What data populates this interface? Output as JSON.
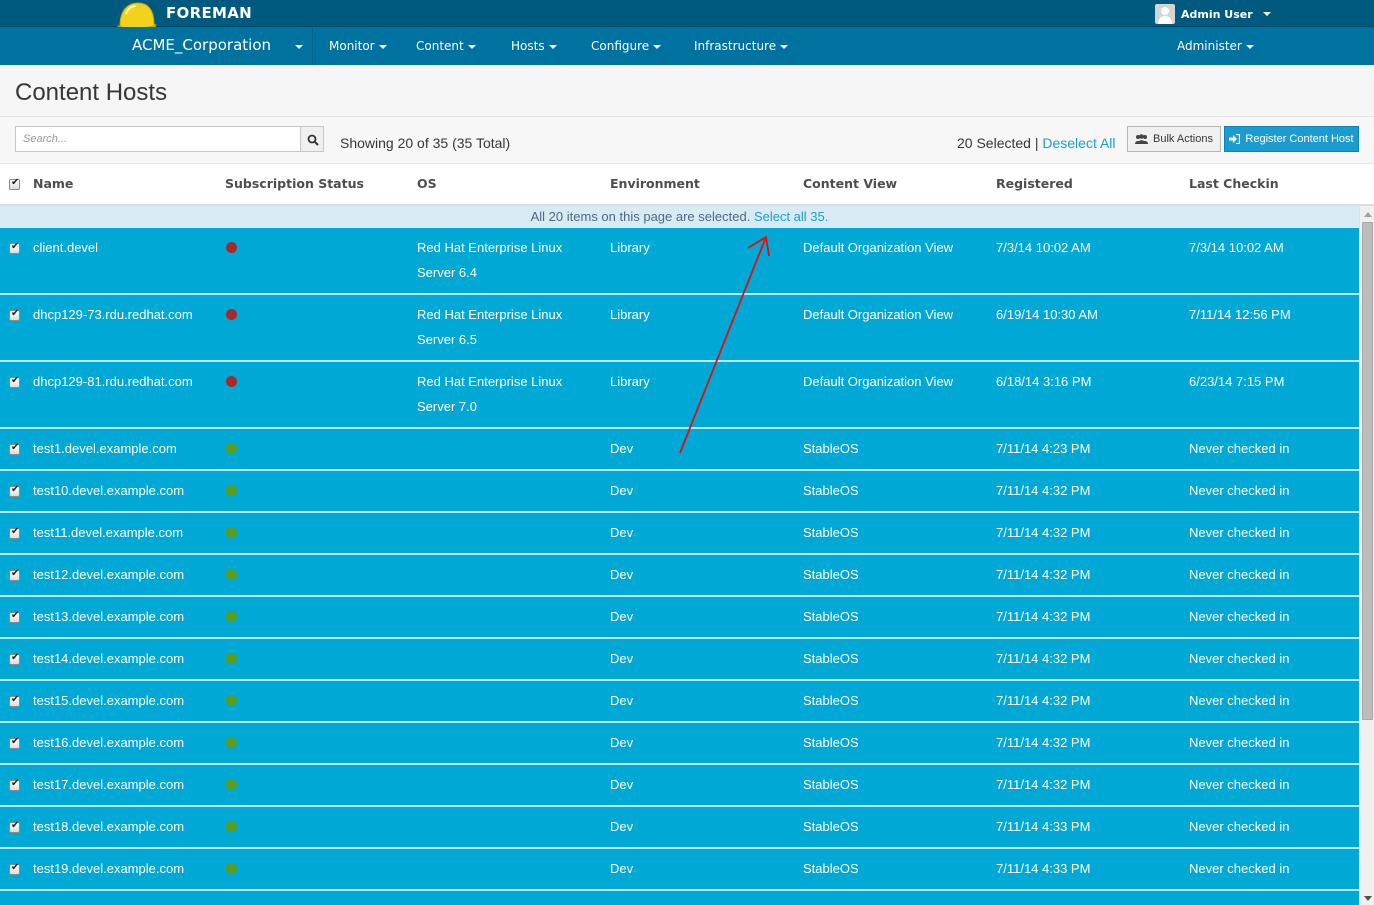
{
  "header": {
    "brand": "FOREMAN",
    "user": "Admin User",
    "organization": "ACME_Corporation",
    "menu": [
      {
        "label": "Monitor"
      },
      {
        "label": "Content"
      },
      {
        "label": "Hosts"
      },
      {
        "label": "Configure"
      },
      {
        "label": "Infrastructure"
      }
    ],
    "admin_menu": "Administer"
  },
  "page": {
    "title": "Content Hosts"
  },
  "toolbar": {
    "search_placeholder": "Search...",
    "showing": "Showing 20 of 35 (35 Total)",
    "selected_count": "20 Selected",
    "separator": "|",
    "deselect_all": "Deselect All",
    "bulk_actions": "Bulk Actions",
    "register": "Register Content Host"
  },
  "table": {
    "columns": [
      "Name",
      "Subscription Status",
      "OS",
      "Environment",
      "Content View",
      "Registered",
      "Last Checkin"
    ],
    "selection_banner": {
      "text": "All 20 items on this page are selected.",
      "link": "Select all 35."
    },
    "status_colors": {
      "red": "#a92828",
      "green": "#5a9e20"
    },
    "rows": [
      {
        "name": "client.devel",
        "status": "red",
        "os": [
          "Red Hat Enterprise Linux",
          "Server 6.4"
        ],
        "environment": "Library",
        "content_view": "Default Organization View",
        "registered": "7/3/14 10:02 AM",
        "last_checkin": "7/3/14 10:02 AM",
        "checked": true
      },
      {
        "name": "dhcp129-73.rdu.redhat.com",
        "status": "red",
        "os": [
          "Red Hat Enterprise Linux",
          "Server 6.5"
        ],
        "environment": "Library",
        "content_view": "Default Organization View",
        "registered": "6/19/14 10:30 AM",
        "last_checkin": "7/11/14 12:56 PM",
        "checked": true
      },
      {
        "name": "dhcp129-81.rdu.redhat.com",
        "status": "red",
        "os": [
          "Red Hat Enterprise Linux",
          "Server 7.0"
        ],
        "environment": "Library",
        "content_view": "Default Organization View",
        "registered": "6/18/14 3:16 PM",
        "last_checkin": "6/23/14 7:15 PM",
        "checked": true
      },
      {
        "name": "test1.devel.example.com",
        "status": "green",
        "os": [
          "",
          ""
        ],
        "environment": "Dev",
        "content_view": "StableOS",
        "registered": "7/11/14 4:23 PM",
        "last_checkin": "Never checked in",
        "checked": true
      },
      {
        "name": "test10.devel.example.com",
        "status": "green",
        "os": [
          "",
          ""
        ],
        "environment": "Dev",
        "content_view": "StableOS",
        "registered": "7/11/14 4:32 PM",
        "last_checkin": "Never checked in",
        "checked": true
      },
      {
        "name": "test11.devel.example.com",
        "status": "green",
        "os": [
          "",
          ""
        ],
        "environment": "Dev",
        "content_view": "StableOS",
        "registered": "7/11/14 4:32 PM",
        "last_checkin": "Never checked in",
        "checked": true
      },
      {
        "name": "test12.devel.example.com",
        "status": "green",
        "os": [
          "",
          ""
        ],
        "environment": "Dev",
        "content_view": "StableOS",
        "registered": "7/11/14 4:32 PM",
        "last_checkin": "Never checked in",
        "checked": true
      },
      {
        "name": "test13.devel.example.com",
        "status": "green",
        "os": [
          "",
          ""
        ],
        "environment": "Dev",
        "content_view": "StableOS",
        "registered": "7/11/14 4:32 PM",
        "last_checkin": "Never checked in",
        "checked": true
      },
      {
        "name": "test14.devel.example.com",
        "status": "green",
        "os": [
          "",
          ""
        ],
        "environment": "Dev",
        "content_view": "StableOS",
        "registered": "7/11/14 4:32 PM",
        "last_checkin": "Never checked in",
        "checked": true
      },
      {
        "name": "test15.devel.example.com",
        "status": "green",
        "os": [
          "",
          ""
        ],
        "environment": "Dev",
        "content_view": "StableOS",
        "registered": "7/11/14 4:32 PM",
        "last_checkin": "Never checked in",
        "checked": true
      },
      {
        "name": "test16.devel.example.com",
        "status": "green",
        "os": [
          "",
          ""
        ],
        "environment": "Dev",
        "content_view": "StableOS",
        "registered": "7/11/14 4:32 PM",
        "last_checkin": "Never checked in",
        "checked": true
      },
      {
        "name": "test17.devel.example.com",
        "status": "green",
        "os": [
          "",
          ""
        ],
        "environment": "Dev",
        "content_view": "StableOS",
        "registered": "7/11/14 4:32 PM",
        "last_checkin": "Never checked in",
        "checked": true
      },
      {
        "name": "test18.devel.example.com",
        "status": "green",
        "os": [
          "",
          ""
        ],
        "environment": "Dev",
        "content_view": "StableOS",
        "registered": "7/11/14 4:33 PM",
        "last_checkin": "Never checked in",
        "checked": true
      },
      {
        "name": "test19.devel.example.com",
        "status": "green",
        "os": [
          "",
          ""
        ],
        "environment": "Dev",
        "content_view": "StableOS",
        "registered": "7/11/14 4:33 PM",
        "last_checkin": "Never checked in",
        "checked": true
      }
    ]
  }
}
